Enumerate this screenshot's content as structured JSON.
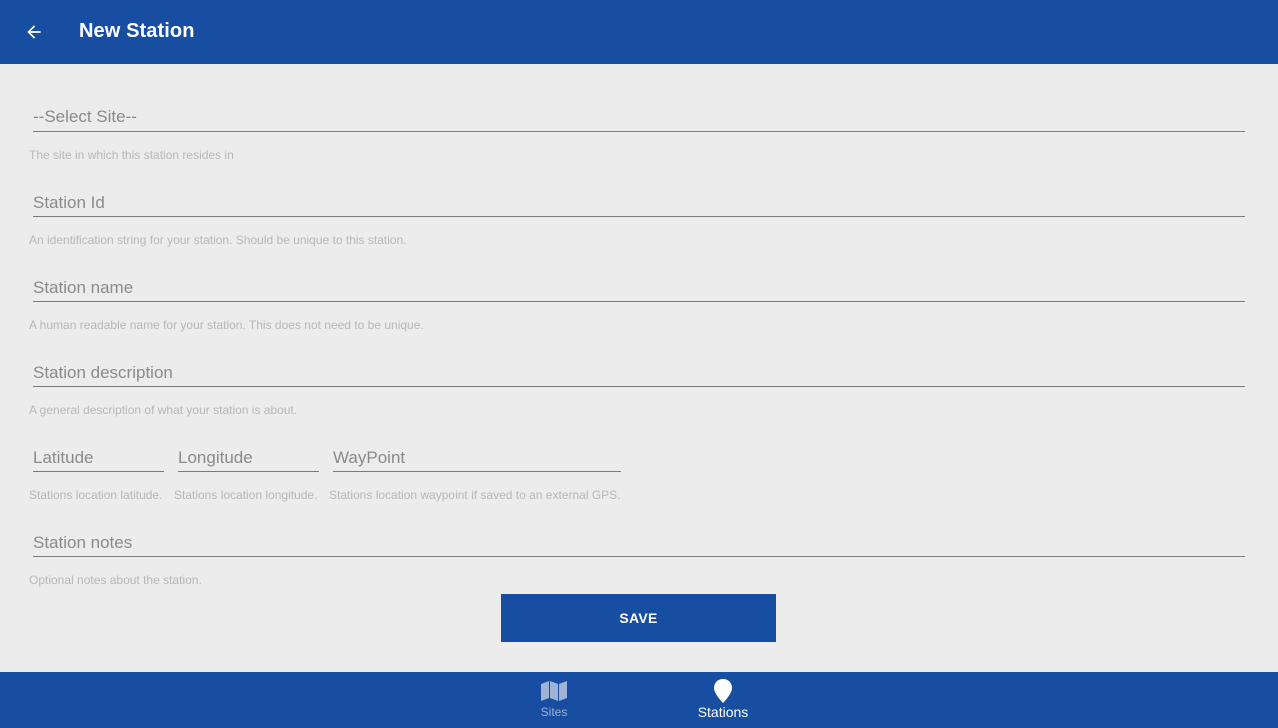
{
  "app_bar": {
    "title": "New Station",
    "back_icon": "arrow-back-icon"
  },
  "form": {
    "site": {
      "selected": "--Select Site--",
      "helper": "The site in which this station resides in"
    },
    "station_id": {
      "placeholder": "Station Id",
      "value": "",
      "helper": "An identification string for your station. Should be unique to this station."
    },
    "station_name": {
      "placeholder": "Station name",
      "value": "",
      "helper": "A human readable name for your station. This does not need to be unique."
    },
    "station_description": {
      "placeholder": "Station description",
      "value": "",
      "helper": "A general description of what your station is about."
    },
    "latitude": {
      "placeholder": "Latitude",
      "value": "",
      "helper": "Stations location latitude."
    },
    "longitude": {
      "placeholder": "Longitude",
      "value": "",
      "helper": "Stations location longitude."
    },
    "waypoint": {
      "placeholder": "WayPoint",
      "value": "",
      "helper": "Stations location waypoint if saved to an external GPS."
    },
    "station_notes": {
      "placeholder": "Station notes",
      "value": "",
      "helper": "Optional notes about the station."
    },
    "save_label": "SAVE"
  },
  "bottom_nav": {
    "items": [
      {
        "label": "Sites",
        "icon": "map-icon",
        "active": false
      },
      {
        "label": "Stations",
        "icon": "location-pin-icon",
        "active": true
      }
    ]
  },
  "colors": {
    "primary": "#174ea1",
    "background": "#ececec",
    "helper_text": "#b7b7b7",
    "placeholder_text": "#8a8a8a"
  }
}
